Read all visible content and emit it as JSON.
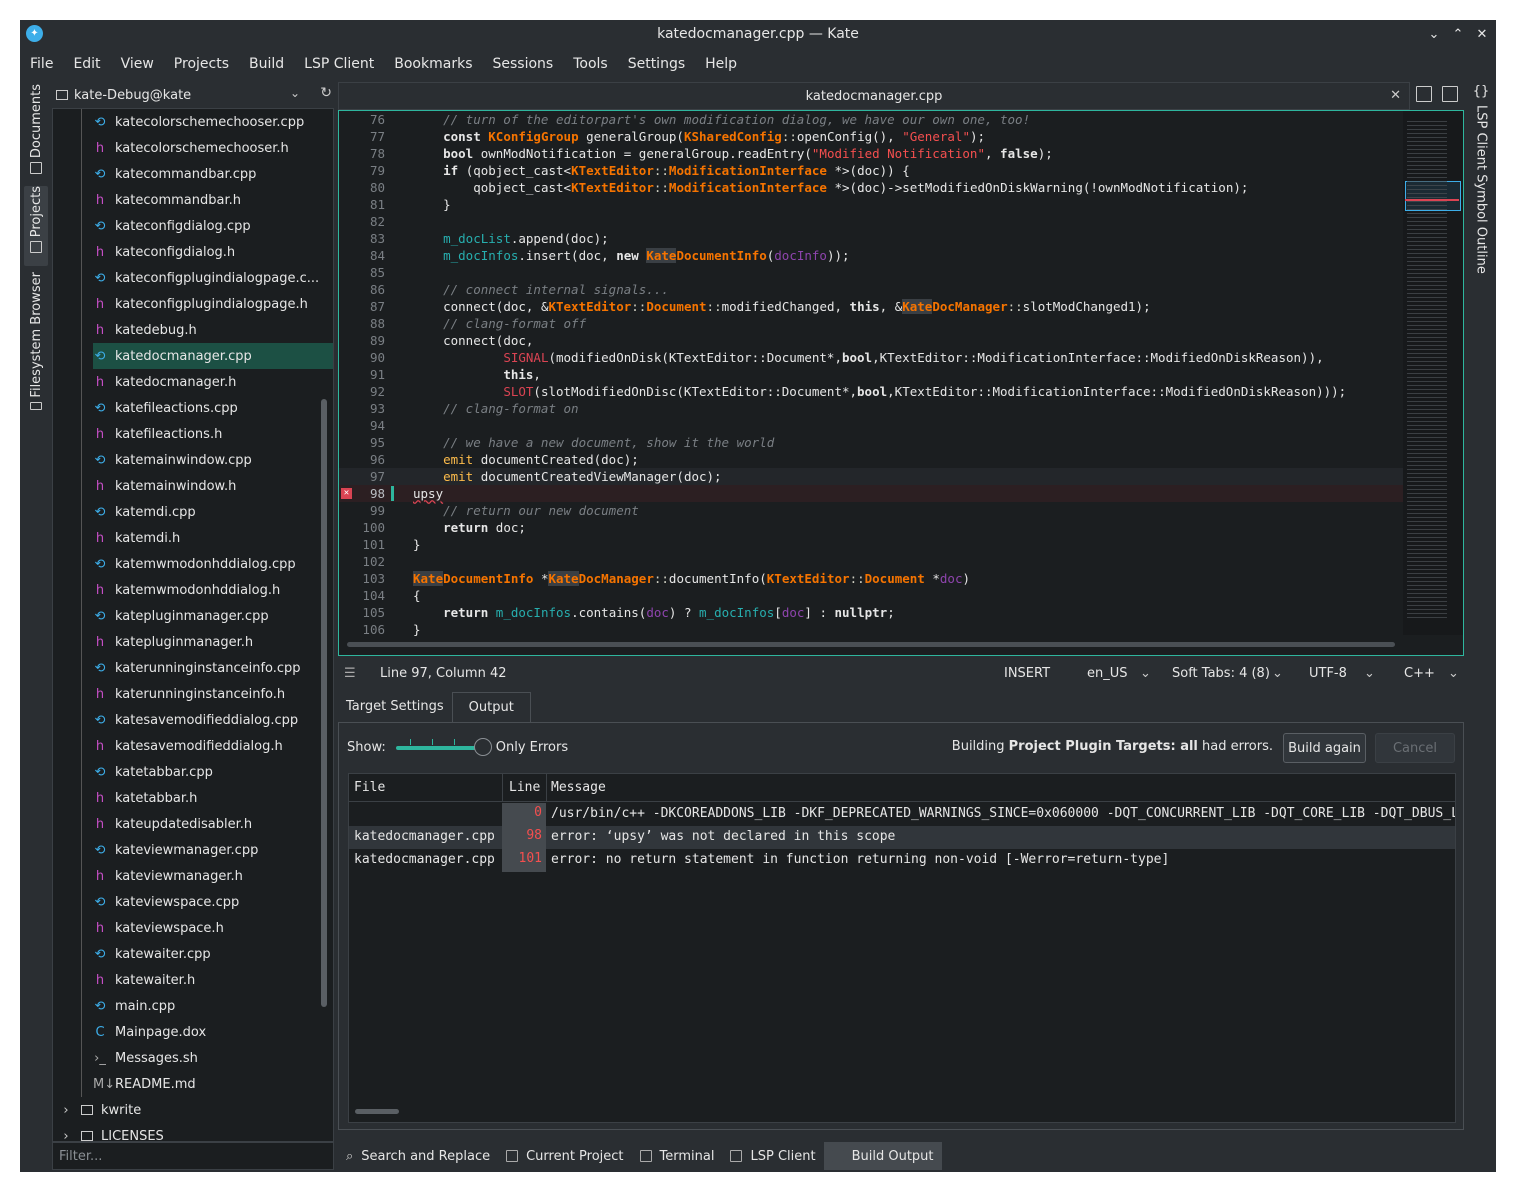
{
  "window": {
    "title": "katedocmanager.cpp — Kate"
  },
  "menu": [
    "File",
    "Edit",
    "View",
    "Projects",
    "Build",
    "LSP Client",
    "Bookmarks",
    "Sessions",
    "Tools",
    "Settings",
    "Help"
  ],
  "left_tabs": {
    "documents": "Documents",
    "projects": "Projects",
    "filesystem": "Filesystem Browser"
  },
  "project": {
    "name": "kate-Debug@kate"
  },
  "tree": [
    {
      "name": "katecolorschemechooser.cpp",
      "type": "cpp"
    },
    {
      "name": "katecolorschemechooser.h",
      "type": "h"
    },
    {
      "name": "katecommandbar.cpp",
      "type": "cpp"
    },
    {
      "name": "katecommandbar.h",
      "type": "h"
    },
    {
      "name": "kateconfigdialog.cpp",
      "type": "cpp"
    },
    {
      "name": "kateconfigdialog.h",
      "type": "h"
    },
    {
      "name": "kateconfigplugindialogpage.c...",
      "type": "cpp"
    },
    {
      "name": "kateconfigplugindialogpage.h",
      "type": "h"
    },
    {
      "name": "katedebug.h",
      "type": "h"
    },
    {
      "name": "katedocmanager.cpp",
      "type": "cpp",
      "selected": true
    },
    {
      "name": "katedocmanager.h",
      "type": "h"
    },
    {
      "name": "katefileactions.cpp",
      "type": "cpp"
    },
    {
      "name": "katefileactions.h",
      "type": "h"
    },
    {
      "name": "katemainwindow.cpp",
      "type": "cpp"
    },
    {
      "name": "katemainwindow.h",
      "type": "h"
    },
    {
      "name": "katemdi.cpp",
      "type": "cpp"
    },
    {
      "name": "katemdi.h",
      "type": "h"
    },
    {
      "name": "katemwmodonhddialog.cpp",
      "type": "cpp"
    },
    {
      "name": "katemwmodonhddialog.h",
      "type": "h"
    },
    {
      "name": "katepluginmanager.cpp",
      "type": "cpp"
    },
    {
      "name": "katepluginmanager.h",
      "type": "h"
    },
    {
      "name": "katerunninginstanceinfo.cpp",
      "type": "cpp"
    },
    {
      "name": "katerunninginstanceinfo.h",
      "type": "h"
    },
    {
      "name": "katesavemodifieddialog.cpp",
      "type": "cpp"
    },
    {
      "name": "katesavemodifieddialog.h",
      "type": "h"
    },
    {
      "name": "katetabbar.cpp",
      "type": "cpp"
    },
    {
      "name": "katetabbar.h",
      "type": "h"
    },
    {
      "name": "kateupdatedisabler.h",
      "type": "h"
    },
    {
      "name": "kateviewmanager.cpp",
      "type": "cpp"
    },
    {
      "name": "kateviewmanager.h",
      "type": "h"
    },
    {
      "name": "kateviewspace.cpp",
      "type": "cpp"
    },
    {
      "name": "kateviewspace.h",
      "type": "h"
    },
    {
      "name": "katewaiter.cpp",
      "type": "cpp"
    },
    {
      "name": "katewaiter.h",
      "type": "h"
    },
    {
      "name": "main.cpp",
      "type": "cpp"
    },
    {
      "name": "Mainpage.dox",
      "type": "dox"
    },
    {
      "name": "Messages.sh",
      "type": "sh"
    },
    {
      "name": "README.md",
      "type": "md"
    }
  ],
  "tree_folders": [
    {
      "name": "kwrite"
    },
    {
      "name": "LICENSES"
    }
  ],
  "filter": {
    "placeholder": "Filter..."
  },
  "editor": {
    "tab_title": "katedocmanager.cpp"
  },
  "right_tabs": {
    "outline": "LSP Client Symbol Outline"
  },
  "status": {
    "position": "Line 97, Column 42",
    "mode": "INSERT",
    "lang": "en_US",
    "tabs": "Soft Tabs: 4 (8)",
    "encoding": "UTF-8",
    "syntax": "C++"
  },
  "build_tabs": {
    "target": "Target Settings",
    "output": "Output"
  },
  "build": {
    "show_label": "Show:",
    "filter_label": "Only Errors",
    "status_prefix": "Building ",
    "status_bold": "Project Plugin Targets: all",
    "status_suffix": " had errors.",
    "build_again": "Build again",
    "cancel": "Cancel",
    "columns": {
      "file": "File",
      "line": "Line",
      "message": "Message"
    },
    "rows": [
      {
        "file": "",
        "line": "0",
        "message": "/usr/bin/c++ -DKCOREADDONS_LIB -DKF_DEPRECATED_WARNINGS_SINCE=0x060000 -DQT_CONCURRENT_LIB -DQT_CORE_LIB -DQT_DBUS_L"
      },
      {
        "file": "katedocmanager.cpp",
        "line": "98",
        "message": "error: ‘upsy’ was not declared in this scope"
      },
      {
        "file": "katedocmanager.cpp",
        "line": "101",
        "message": "error: no return statement in function returning non-void [-Werror=return-type]"
      }
    ]
  },
  "bottom_tabs": [
    "Search and Replace",
    "Current Project",
    "Terminal",
    "LSP Client",
    "Build Output"
  ]
}
